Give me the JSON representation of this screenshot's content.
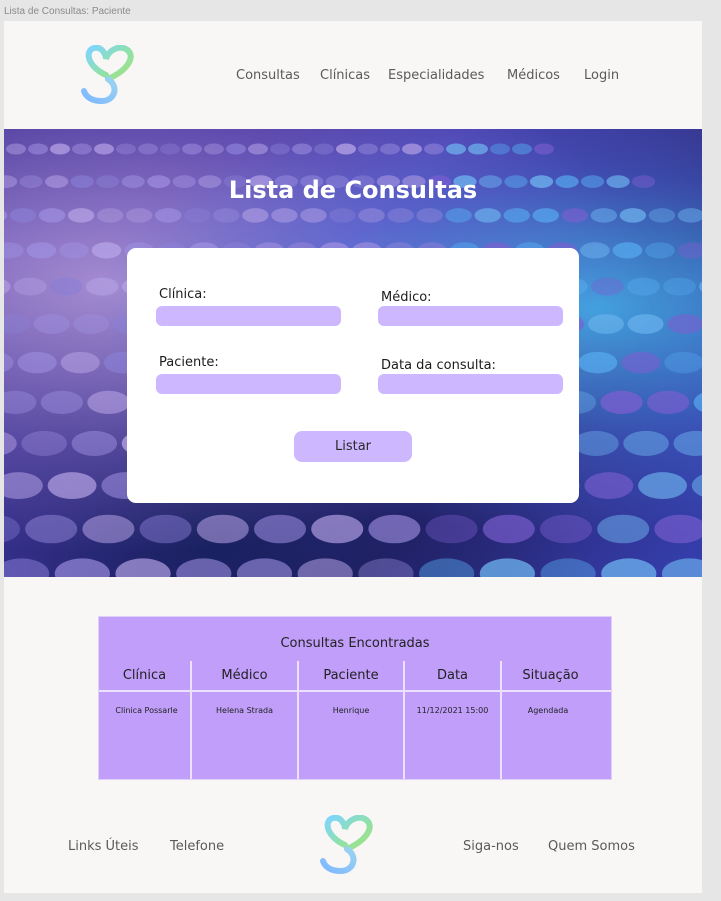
{
  "frame_label": "Lista de Consultas: Paciente",
  "header": {
    "logo_icon": "heart-s-logo-icon",
    "nav": [
      {
        "label": "Consultas"
      },
      {
        "label": "Clínicas"
      },
      {
        "label": "Especialidades"
      },
      {
        "label": "Médicos"
      },
      {
        "label": "Login"
      }
    ]
  },
  "hero": {
    "title": "Lista de Consultas",
    "form": {
      "clinica_label": "Clínica:",
      "clinica_value": "",
      "medico_label": "Médico:",
      "medico_value": "",
      "paciente_label": "Paciente:",
      "paciente_value": "",
      "data_label": "Data da consulta:",
      "data_value": "",
      "submit_label": "Listar"
    }
  },
  "results": {
    "title": "Consultas Encontradas",
    "columns": [
      "Clínica",
      "Médico",
      "Paciente",
      "Data",
      "Situação"
    ],
    "rows": [
      [
        "Clinica Possarle",
        "Helena Strada",
        "Henrique",
        "11/12/2021 15:00",
        "Agendada"
      ]
    ]
  },
  "footer": {
    "links_label": "Links Úteis",
    "phone_label": "Telefone",
    "follow_label": "Siga-nos",
    "about_label": "Quem Somos",
    "logo_icon": "heart-s-logo-icon"
  },
  "colors": {
    "accent": "#cdb7ff",
    "table_bg": "#c09efa",
    "page_bg": "#f8f7f5"
  }
}
